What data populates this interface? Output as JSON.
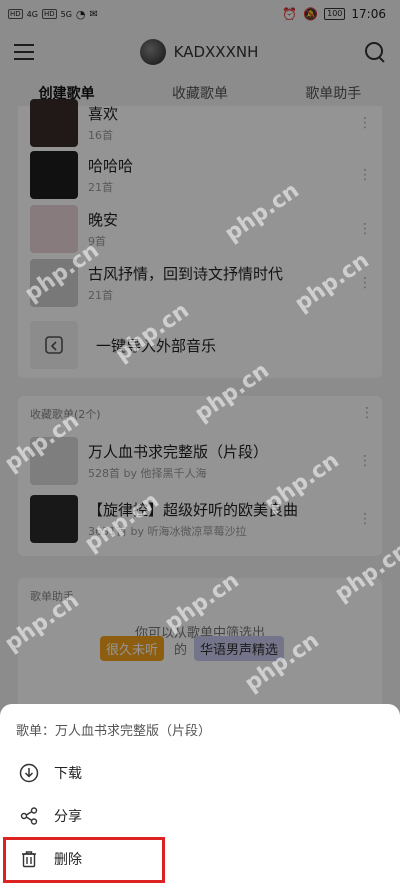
{
  "status_bar": {
    "left_chip_1": "HD",
    "left_chip_2": "HD",
    "network_1": "4G",
    "network_2": "5G",
    "battery": "100",
    "time": "17:06"
  },
  "header": {
    "username": "KADXXXNH"
  },
  "tabs": [
    {
      "label": "创建歌单"
    },
    {
      "label": "收藏歌单"
    },
    {
      "label": "歌单助手"
    }
  ],
  "created_playlists": [
    {
      "title": "喜欢",
      "sub": "16首",
      "cover": "#3a2a2a"
    },
    {
      "title": "哈哈哈",
      "sub": "21首",
      "cover": "#1e1e1e"
    },
    {
      "title": "晚安",
      "sub": "9首",
      "cover": "#e8d4d8"
    },
    {
      "title": "古风抒情，回到诗文抒情时代",
      "sub": "21首",
      "cover": "#cfcfcf"
    }
  ],
  "import": {
    "label": "一键导入外部音乐"
  },
  "collected": {
    "header": "收藏歌单(2个)",
    "items": [
      {
        "title": "万人血书求完整版（片段）",
        "sub": "528首  by 他择黑千人海",
        "cover": "#d9d9d9"
      },
      {
        "title": "【旋律控】超级好听的欧美良曲",
        "sub": "3631首  by 听海冰微凉草莓沙拉",
        "cover": "#2a2a2a"
      }
    ]
  },
  "assistant": {
    "header": "歌单助手",
    "desc": "你可以从歌单中筛选出",
    "chip_1": "很久未听",
    "connector": "的",
    "chip_2": "华语男声精选",
    "chip_1_color": "#f4a31c",
    "chip_2_color": "#c9c9ee"
  },
  "sheet": {
    "title": "歌单：万人血书求完整版（片段）",
    "download": "下载",
    "share": "分享",
    "delete": "删除"
  },
  "watermark": "php.cn",
  "accent_color": "#d33"
}
